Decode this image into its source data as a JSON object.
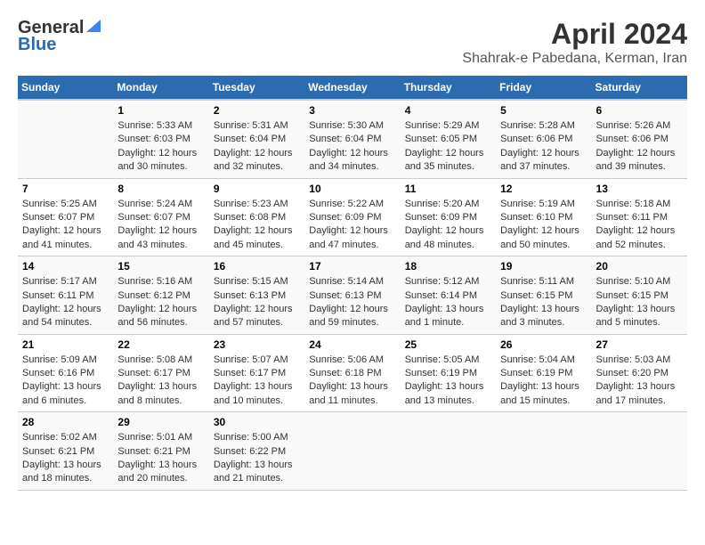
{
  "header": {
    "logo_general": "General",
    "logo_blue": "Blue",
    "month_title": "April 2024",
    "location": "Shahrak-e Pabedana, Kerman, Iran"
  },
  "weekdays": [
    "Sunday",
    "Monday",
    "Tuesday",
    "Wednesday",
    "Thursday",
    "Friday",
    "Saturday"
  ],
  "weeks": [
    [
      {
        "day": "",
        "info": ""
      },
      {
        "day": "1",
        "info": "Sunrise: 5:33 AM\nSunset: 6:03 PM\nDaylight: 12 hours\nand 30 minutes."
      },
      {
        "day": "2",
        "info": "Sunrise: 5:31 AM\nSunset: 6:04 PM\nDaylight: 12 hours\nand 32 minutes."
      },
      {
        "day": "3",
        "info": "Sunrise: 5:30 AM\nSunset: 6:04 PM\nDaylight: 12 hours\nand 34 minutes."
      },
      {
        "day": "4",
        "info": "Sunrise: 5:29 AM\nSunset: 6:05 PM\nDaylight: 12 hours\nand 35 minutes."
      },
      {
        "day": "5",
        "info": "Sunrise: 5:28 AM\nSunset: 6:06 PM\nDaylight: 12 hours\nand 37 minutes."
      },
      {
        "day": "6",
        "info": "Sunrise: 5:26 AM\nSunset: 6:06 PM\nDaylight: 12 hours\nand 39 minutes."
      }
    ],
    [
      {
        "day": "7",
        "info": "Sunrise: 5:25 AM\nSunset: 6:07 PM\nDaylight: 12 hours\nand 41 minutes."
      },
      {
        "day": "8",
        "info": "Sunrise: 5:24 AM\nSunset: 6:07 PM\nDaylight: 12 hours\nand 43 minutes."
      },
      {
        "day": "9",
        "info": "Sunrise: 5:23 AM\nSunset: 6:08 PM\nDaylight: 12 hours\nand 45 minutes."
      },
      {
        "day": "10",
        "info": "Sunrise: 5:22 AM\nSunset: 6:09 PM\nDaylight: 12 hours\nand 47 minutes."
      },
      {
        "day": "11",
        "info": "Sunrise: 5:20 AM\nSunset: 6:09 PM\nDaylight: 12 hours\nand 48 minutes."
      },
      {
        "day": "12",
        "info": "Sunrise: 5:19 AM\nSunset: 6:10 PM\nDaylight: 12 hours\nand 50 minutes."
      },
      {
        "day": "13",
        "info": "Sunrise: 5:18 AM\nSunset: 6:11 PM\nDaylight: 12 hours\nand 52 minutes."
      }
    ],
    [
      {
        "day": "14",
        "info": "Sunrise: 5:17 AM\nSunset: 6:11 PM\nDaylight: 12 hours\nand 54 minutes."
      },
      {
        "day": "15",
        "info": "Sunrise: 5:16 AM\nSunset: 6:12 PM\nDaylight: 12 hours\nand 56 minutes."
      },
      {
        "day": "16",
        "info": "Sunrise: 5:15 AM\nSunset: 6:13 PM\nDaylight: 12 hours\nand 57 minutes."
      },
      {
        "day": "17",
        "info": "Sunrise: 5:14 AM\nSunset: 6:13 PM\nDaylight: 12 hours\nand 59 minutes."
      },
      {
        "day": "18",
        "info": "Sunrise: 5:12 AM\nSunset: 6:14 PM\nDaylight: 13 hours\nand 1 minute."
      },
      {
        "day": "19",
        "info": "Sunrise: 5:11 AM\nSunset: 6:15 PM\nDaylight: 13 hours\nand 3 minutes."
      },
      {
        "day": "20",
        "info": "Sunrise: 5:10 AM\nSunset: 6:15 PM\nDaylight: 13 hours\nand 5 minutes."
      }
    ],
    [
      {
        "day": "21",
        "info": "Sunrise: 5:09 AM\nSunset: 6:16 PM\nDaylight: 13 hours\nand 6 minutes."
      },
      {
        "day": "22",
        "info": "Sunrise: 5:08 AM\nSunset: 6:17 PM\nDaylight: 13 hours\nand 8 minutes."
      },
      {
        "day": "23",
        "info": "Sunrise: 5:07 AM\nSunset: 6:17 PM\nDaylight: 13 hours\nand 10 minutes."
      },
      {
        "day": "24",
        "info": "Sunrise: 5:06 AM\nSunset: 6:18 PM\nDaylight: 13 hours\nand 11 minutes."
      },
      {
        "day": "25",
        "info": "Sunrise: 5:05 AM\nSunset: 6:19 PM\nDaylight: 13 hours\nand 13 minutes."
      },
      {
        "day": "26",
        "info": "Sunrise: 5:04 AM\nSunset: 6:19 PM\nDaylight: 13 hours\nand 15 minutes."
      },
      {
        "day": "27",
        "info": "Sunrise: 5:03 AM\nSunset: 6:20 PM\nDaylight: 13 hours\nand 17 minutes."
      }
    ],
    [
      {
        "day": "28",
        "info": "Sunrise: 5:02 AM\nSunset: 6:21 PM\nDaylight: 13 hours\nand 18 minutes."
      },
      {
        "day": "29",
        "info": "Sunrise: 5:01 AM\nSunset: 6:21 PM\nDaylight: 13 hours\nand 20 minutes."
      },
      {
        "day": "30",
        "info": "Sunrise: 5:00 AM\nSunset: 6:22 PM\nDaylight: 13 hours\nand 21 minutes."
      },
      {
        "day": "",
        "info": ""
      },
      {
        "day": "",
        "info": ""
      },
      {
        "day": "",
        "info": ""
      },
      {
        "day": "",
        "info": ""
      }
    ]
  ]
}
